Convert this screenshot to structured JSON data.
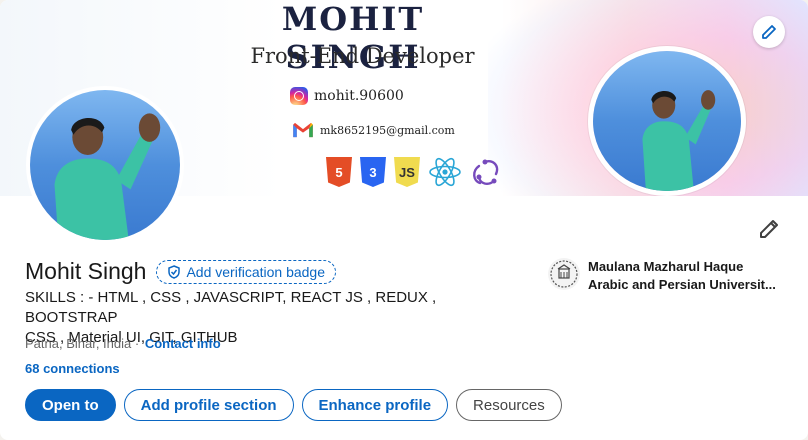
{
  "banner": {
    "name": "MOHIT SINGH",
    "role": "Front-End Developer",
    "instagram": "mohit.90600",
    "email": "mk8652195@gmail.com",
    "tech_icons": [
      "html5-icon",
      "css3-icon",
      "javascript-icon",
      "react-icon",
      "redux-icon"
    ]
  },
  "profile": {
    "name": "Mohit Singh",
    "verification_label": "Add verification badge",
    "headline_line1": "SKILLS : - HTML , CSS , JAVASCRIPT, REACT JS , REDUX , BOOTSTRAP",
    "headline_line2": "CSS , Material UI, GIT, GITHUB",
    "location": "Patna, Bihar, India",
    "separator": " · ",
    "contact_info": "Contact info",
    "connections": "68 connections"
  },
  "education": {
    "line1": "Maulana Mazharul Haque",
    "line2": "Arabic and Persian Universit..."
  },
  "actions": {
    "open_to": "Open to",
    "add_section": "Add profile section",
    "enhance": "Enhance profile",
    "resources": "Resources"
  },
  "colors": {
    "accent": "#0a66c2",
    "shirt": "#3cc2a5"
  }
}
